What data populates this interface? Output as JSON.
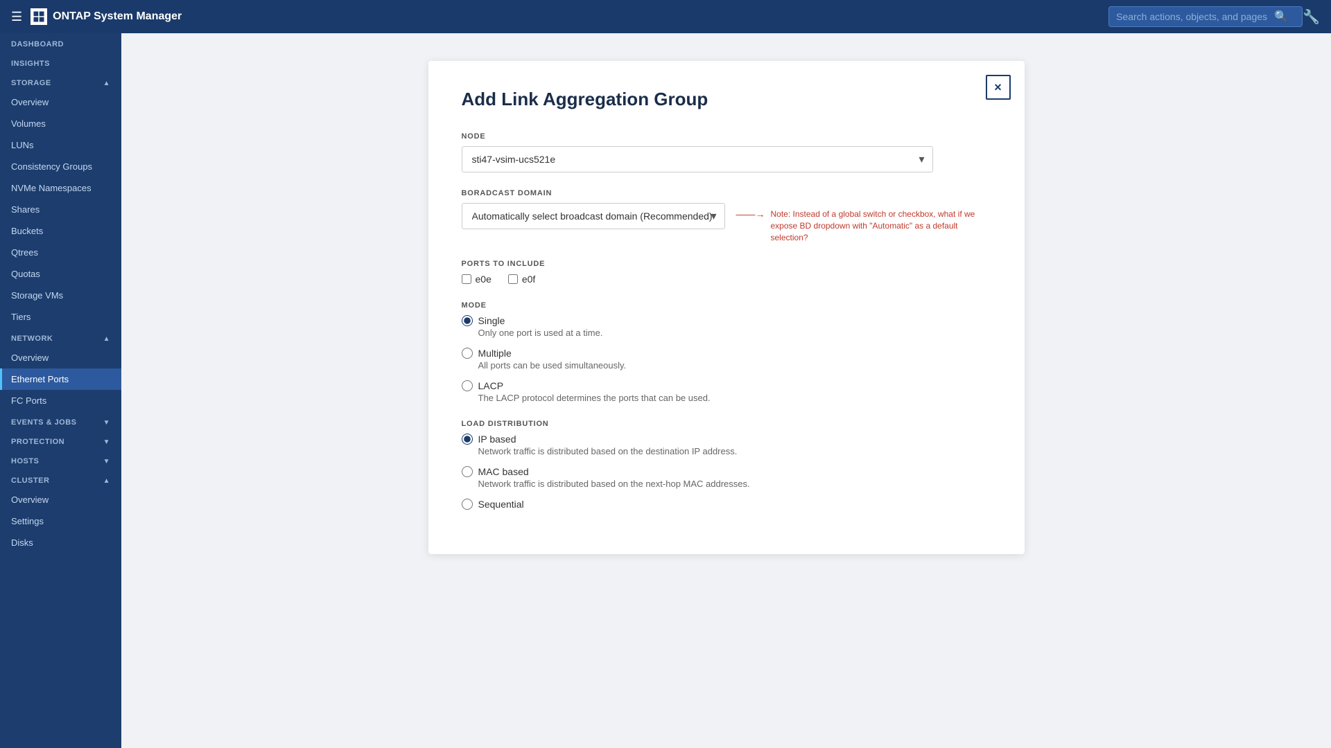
{
  "topNav": {
    "hamburger": "☰",
    "appName": "ONTAP System Manager",
    "searchPlaceholder": "Search actions, objects, and pages",
    "profileIcon": "🔧"
  },
  "sidebar": {
    "sections": [
      {
        "id": "dashboard",
        "label": "DASHBOARD",
        "collapsible": false,
        "items": []
      },
      {
        "id": "insights",
        "label": "INSIGHTS",
        "collapsible": false,
        "items": []
      },
      {
        "id": "storage",
        "label": "STORAGE",
        "collapsible": true,
        "expanded": true,
        "items": [
          {
            "id": "overview",
            "label": "Overview",
            "active": false
          },
          {
            "id": "volumes",
            "label": "Volumes",
            "active": false
          },
          {
            "id": "luns",
            "label": "LUNs",
            "active": false
          },
          {
            "id": "consistency-groups",
            "label": "Consistency Groups",
            "active": false
          },
          {
            "id": "nvme-namespaces",
            "label": "NVMe Namespaces",
            "active": false
          },
          {
            "id": "shares",
            "label": "Shares",
            "active": false
          },
          {
            "id": "buckets",
            "label": "Buckets",
            "active": false
          },
          {
            "id": "qtrees",
            "label": "Qtrees",
            "active": false
          },
          {
            "id": "quotas",
            "label": "Quotas",
            "active": false
          },
          {
            "id": "storage-vms",
            "label": "Storage VMs",
            "active": false
          },
          {
            "id": "tiers",
            "label": "Tiers",
            "active": false
          }
        ]
      },
      {
        "id": "network",
        "label": "NETWORK",
        "collapsible": true,
        "expanded": true,
        "items": [
          {
            "id": "net-overview",
            "label": "Overview",
            "active": false
          },
          {
            "id": "ethernet-ports",
            "label": "Ethernet Ports",
            "active": true
          },
          {
            "id": "fc-ports",
            "label": "FC Ports",
            "active": false
          }
        ]
      },
      {
        "id": "events-jobs",
        "label": "EVENTS & JOBS",
        "collapsible": true,
        "expanded": false,
        "items": []
      },
      {
        "id": "protection",
        "label": "PROTECTION",
        "collapsible": true,
        "expanded": false,
        "items": []
      },
      {
        "id": "hosts",
        "label": "HOSTS",
        "collapsible": true,
        "expanded": false,
        "items": []
      },
      {
        "id": "cluster",
        "label": "CLUSTER",
        "collapsible": true,
        "expanded": true,
        "items": [
          {
            "id": "cluster-overview",
            "label": "Overview",
            "active": false
          },
          {
            "id": "settings",
            "label": "Settings",
            "active": false
          },
          {
            "id": "disks",
            "label": "Disks",
            "active": false
          }
        ]
      }
    ]
  },
  "dialog": {
    "title": "Add Link Aggregation Group",
    "closeLabel": "×",
    "nodeLabel": "NODE",
    "nodeValue": "sti47-vsim-ucs521e",
    "broadcastDomainLabel": "BORADCAST DOMAIN",
    "broadcastDomainValue": "Automatically select broadcast domain (Recommended)",
    "broadcastDomainNote": "Note: Instead of a global switch or checkbox, what if we expose BD dropdown with \"Automatic\" as a default selection?",
    "portsLabel": "PORTS TO INCLUDE",
    "ports": [
      {
        "id": "e0e",
        "label": "e0e",
        "checked": false
      },
      {
        "id": "e0f",
        "label": "e0f",
        "checked": false
      }
    ],
    "modeLabel": "MODE",
    "modes": [
      {
        "id": "single",
        "label": "Single",
        "desc": "Only one port is used at a time.",
        "checked": true
      },
      {
        "id": "multiple",
        "label": "Multiple",
        "desc": "All ports can be used simultaneously.",
        "checked": false
      },
      {
        "id": "lacp",
        "label": "LACP",
        "desc": "The LACP protocol determines the ports that can be used.",
        "checked": false
      }
    ],
    "loadDistLabel": "LOAD DISTRIBUTION",
    "loadDists": [
      {
        "id": "ip-based",
        "label": "IP based",
        "desc": "Network traffic is distributed based on the destination IP address.",
        "checked": true
      },
      {
        "id": "mac-based",
        "label": "MAC based",
        "desc": "Network traffic is distributed based on the next-hop MAC addresses.",
        "checked": false
      },
      {
        "id": "sequential",
        "label": "Sequential",
        "desc": "",
        "checked": false
      }
    ]
  }
}
